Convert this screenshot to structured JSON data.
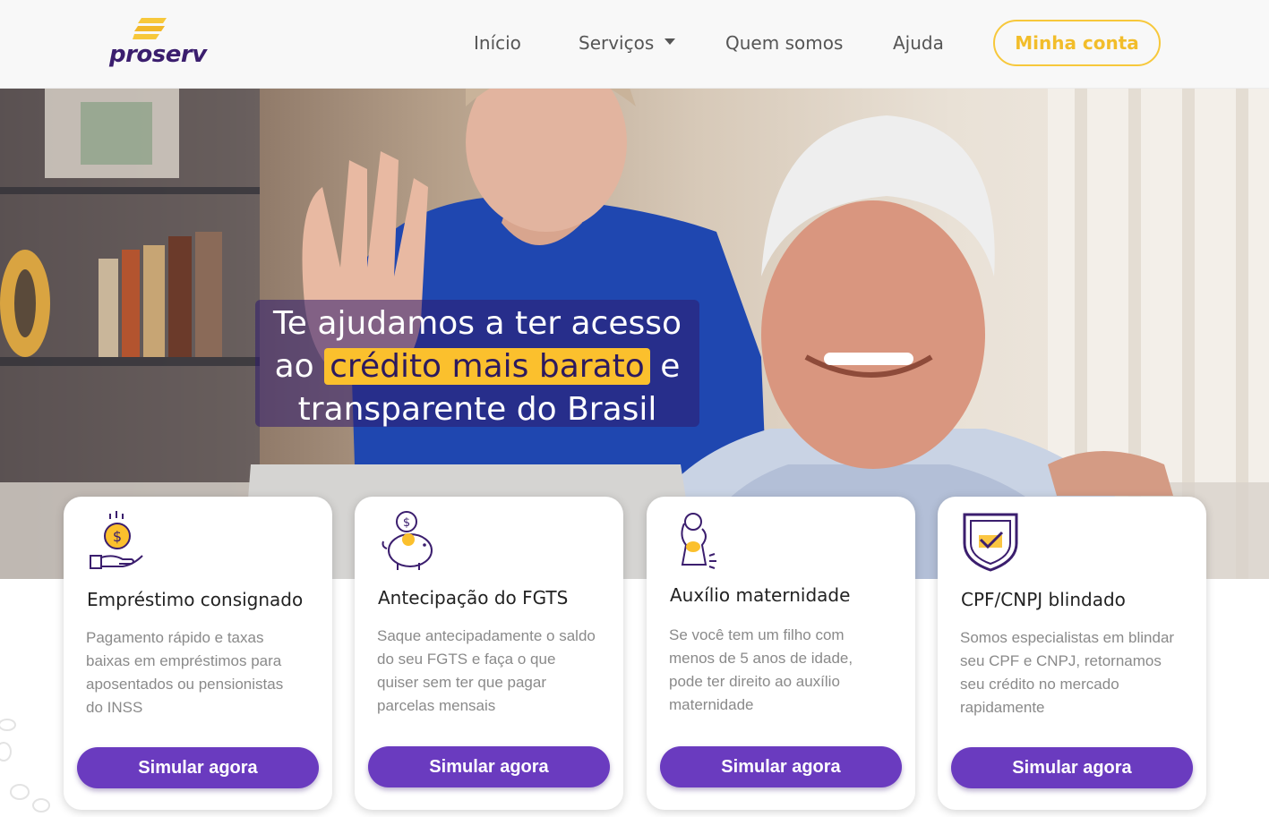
{
  "header": {
    "logo_text": "proserv",
    "nav": [
      {
        "label": "Início"
      },
      {
        "label": "Serviços"
      },
      {
        "label": "Quem somos"
      },
      {
        "label": "Ajuda"
      }
    ],
    "account_button": "Minha conta"
  },
  "hero": {
    "line1": "Te ajudamos a ter acesso",
    "line2_prefix": "ao",
    "line2_highlight": "crédito mais barato",
    "line2_suffix": "e",
    "line3": "transparente do Brasil"
  },
  "cards": [
    {
      "icon": "money-hand-icon",
      "title": "Empréstimo consignado",
      "lines": [
        "Pagamento rápido e taxas",
        "baixas em empréstimos para",
        "aposentados ou pensionistas",
        "do INSS"
      ],
      "button": "Simular agora"
    },
    {
      "icon": "piggy-bank-icon",
      "title": "Antecipação do FGTS",
      "lines": [
        "Saque antecipadamente o saldo",
        "do seu FGTS e faça o que",
        "quiser sem ter que pagar",
        "parcelas mensais"
      ],
      "button": "Simular agora"
    },
    {
      "icon": "mother-baby-icon",
      "title": "Auxílio maternidade",
      "lines": [
        "Se você tem um filho com",
        "menos de 5 anos de idade,",
        "pode ter direito ao auxílio",
        "maternidade"
      ],
      "button": "Simular agora"
    },
    {
      "icon": "shield-check-icon",
      "title": "CPF/CNPJ blindado",
      "lines": [
        "Somos especialistas em blindar",
        "seu CPF e CNPJ, retornamos",
        "seu crédito no mercado",
        "rapidamente"
      ],
      "button": "Simular agora"
    }
  ],
  "colors": {
    "brand_purple": "#6a3bbf",
    "brand_yellow": "#fbc02d",
    "logo_purple": "#3b1e6e"
  }
}
